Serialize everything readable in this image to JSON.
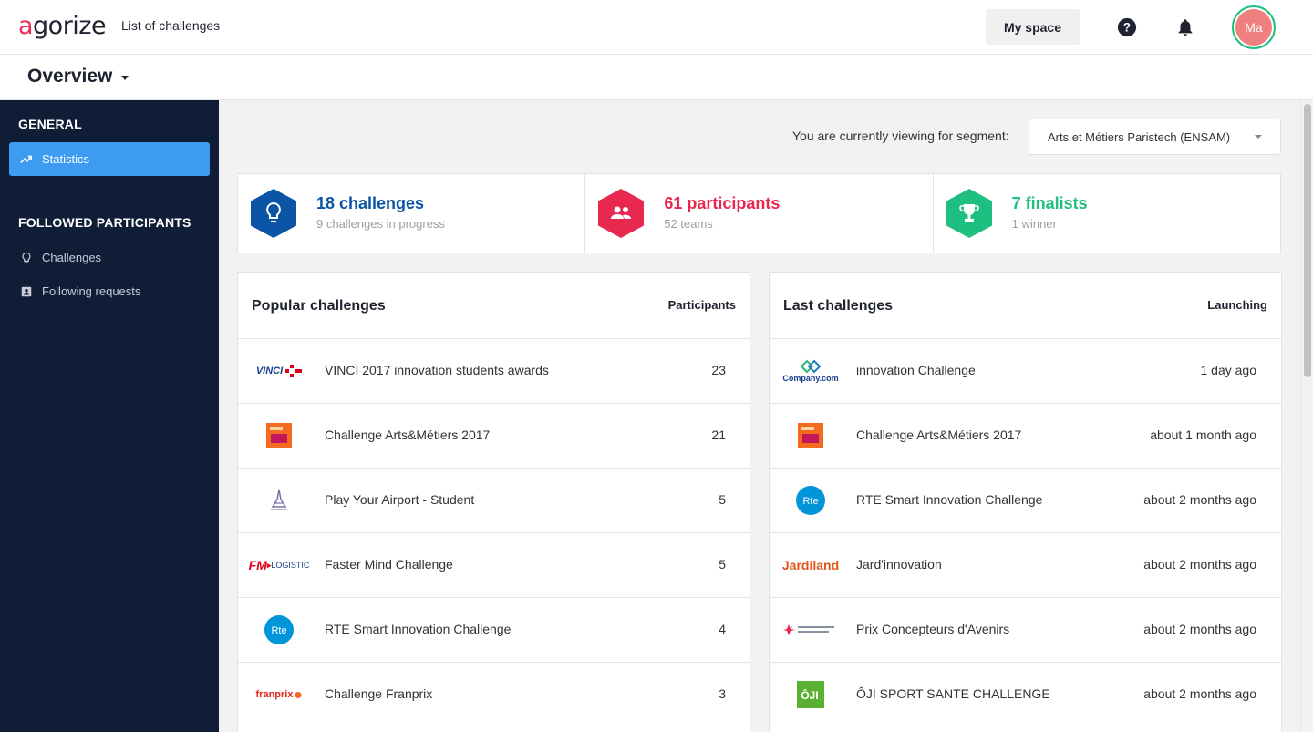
{
  "header": {
    "logo": "agorize",
    "list_link": "List of challenges",
    "my_space": "My space",
    "avatar_initials": "Ma"
  },
  "subheader": {
    "title": "Overview"
  },
  "sidebar": {
    "general_heading": "GENERAL",
    "statistics_label": "Statistics",
    "followed_heading": "FOLLOWED PARTICIPANTS",
    "challenges_label": "Challenges",
    "following_label": "Following requests"
  },
  "segment": {
    "label": "You are currently viewing for segment:",
    "value": "Arts et Métiers Paristech (ENSAM)"
  },
  "stats": [
    {
      "title": "18 challenges",
      "sub": "9 challenges in progress",
      "color": "#0a55a6",
      "icon": "lightbulb-icon"
    },
    {
      "title": "61 participants",
      "sub": "52 teams",
      "color": "#e8284f",
      "icon": "people-icon"
    },
    {
      "title": "7 finalists",
      "sub": "1 winner",
      "color": "#1fbe81",
      "icon": "trophy-icon"
    }
  ],
  "popular": {
    "title": "Popular challenges",
    "column": "Participants",
    "rows": [
      {
        "name": "VINCI 2017 innovation students awards",
        "value": "23",
        "logo": "vinci-logo"
      },
      {
        "name": "Challenge Arts&Métiers 2017",
        "value": "21",
        "logo": "artsmetiers-logo"
      },
      {
        "name": "Play Your Airport - Student",
        "value": "5",
        "logo": "airport-logo"
      },
      {
        "name": "Faster Mind Challenge",
        "value": "5",
        "logo": "fmlogistic-logo"
      },
      {
        "name": "RTE Smart Innovation Challenge",
        "value": "4",
        "logo": "rte-logo"
      },
      {
        "name": "Challenge Franprix",
        "value": "3",
        "logo": "franprix-logo"
      }
    ]
  },
  "last": {
    "title": "Last challenges",
    "column": "Launching",
    "rows": [
      {
        "name": "innovation Challenge",
        "value": "1 day ago",
        "logo": "company-logo"
      },
      {
        "name": "Challenge Arts&Métiers 2017",
        "value": "about 1 month ago",
        "logo": "artsmetiers-logo"
      },
      {
        "name": "RTE Smart Innovation Challenge",
        "value": "about 2 months ago",
        "logo": "rte-logo"
      },
      {
        "name": "Jard'innovation",
        "value": "about 2 months ago",
        "logo": "jardiland-logo"
      },
      {
        "name": "Prix Concepteurs d'Avenirs",
        "value": "about 2 months ago",
        "logo": "concepteurs-logo"
      },
      {
        "name": "ÔJI SPORT SANTE CHALLENGE",
        "value": "about 2 months ago",
        "logo": "oji-logo"
      }
    ]
  },
  "logo_text": {
    "vinci": "VINCI",
    "franprix": "franprix",
    "fm": "FM",
    "logistic": "LOGISTIC",
    "jardiland": "Jardiland",
    "company": "Company.com",
    "rte": "Rte",
    "oji": "ÔJI"
  }
}
